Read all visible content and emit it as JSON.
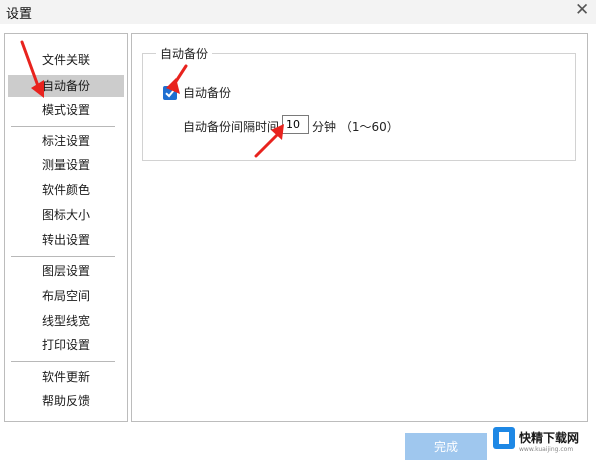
{
  "window": {
    "title": "设置",
    "close_symbol": "✕"
  },
  "sidebar": {
    "items": [
      {
        "label": "文件关联",
        "active": false
      },
      {
        "label": "自动备份",
        "active": true
      },
      {
        "label": "模式设置",
        "active": false
      },
      {
        "label": "标注设置",
        "active": false
      },
      {
        "label": "测量设置",
        "active": false
      },
      {
        "label": "软件颜色",
        "active": false
      },
      {
        "label": "图标大小",
        "active": false
      },
      {
        "label": "转出设置",
        "active": false
      },
      {
        "label": "图层设置",
        "active": false
      },
      {
        "label": "布局空间",
        "active": false
      },
      {
        "label": "线型线宽",
        "active": false
      },
      {
        "label": "打印设置",
        "active": false
      },
      {
        "label": "软件更新",
        "active": false
      },
      {
        "label": "帮助反馈",
        "active": false
      }
    ]
  },
  "autobackup": {
    "group_title": "自动备份",
    "checkbox_label": "自动备份",
    "checkbox_checked": true,
    "interval_label": "自动备份间隔时间",
    "interval_value": "10",
    "unit_label": "分钟 （1～60）"
  },
  "footer": {
    "done_label": "完成"
  },
  "watermark": {
    "text": "快精下载网",
    "url": "www.kuaijing.com"
  },
  "colors": {
    "accent": "#1f6fd1",
    "annotation_arrow": "#e8231e",
    "done_button": "#9fc7ee"
  },
  "icons": {
    "close": "close-icon",
    "checkbox": "check-icon",
    "annotation": "red-arrow"
  }
}
